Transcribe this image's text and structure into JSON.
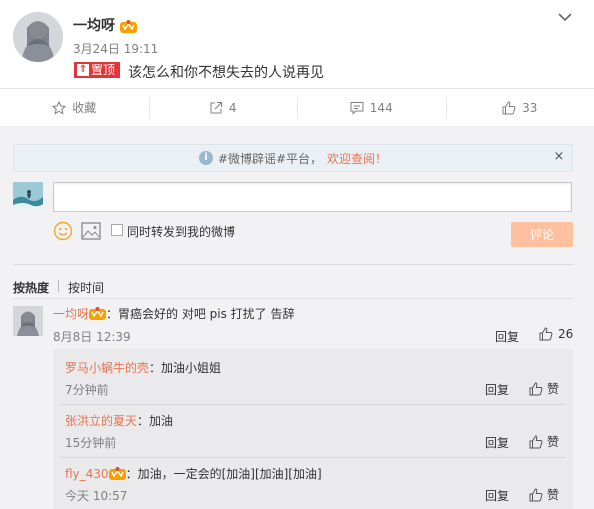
{
  "post": {
    "username": "一均呀",
    "time": "3月24日 19:11",
    "pin_label": "置顶",
    "pin_symbol": "⇑",
    "text": "该怎么和你不想失去的人说再见"
  },
  "actions": [
    {
      "icon": "star-icon",
      "label": "收藏"
    },
    {
      "icon": "share-icon",
      "label": "4"
    },
    {
      "icon": "comment-icon",
      "label": "144"
    },
    {
      "icon": "thumbs-up-icon",
      "label": "33"
    }
  ],
  "notice": {
    "info_symbol": "i",
    "text": "#微博辟谣#平台，",
    "link": "欢迎查阅！",
    "close": "×"
  },
  "composer": {
    "input_value": "",
    "forward_label": "同时转发到我的微博",
    "submit_label": "评论"
  },
  "sort": {
    "hot": "按热度",
    "time": "按时间"
  },
  "comment": {
    "nick": "一均呀",
    "text": "：胃癌会好的 对吧 pis 打扰了 告辞",
    "time": "8月8日 12:39",
    "reply": "回复",
    "likes": "26"
  },
  "replies": [
    {
      "nick": "罗马小蜗牛的壳",
      "text": "：加油小姐姐",
      "time": "7分钟前",
      "reply": "回复",
      "like": "赞",
      "vip": false
    },
    {
      "nick": "张洪立的夏天",
      "text": "：加油",
      "time": "15分钟前",
      "reply": "回复",
      "like": "赞",
      "vip": false
    },
    {
      "nick": "fly_430",
      "text": "：加油，一定会的[加油][加油][加油]",
      "time": "今天 10:57",
      "reply": "回复",
      "like": "赞",
      "vip": true
    }
  ],
  "colors": {
    "accent": "#eb7350",
    "pin_red": "#e0363a",
    "submit_disabled": "#ffc09f"
  }
}
